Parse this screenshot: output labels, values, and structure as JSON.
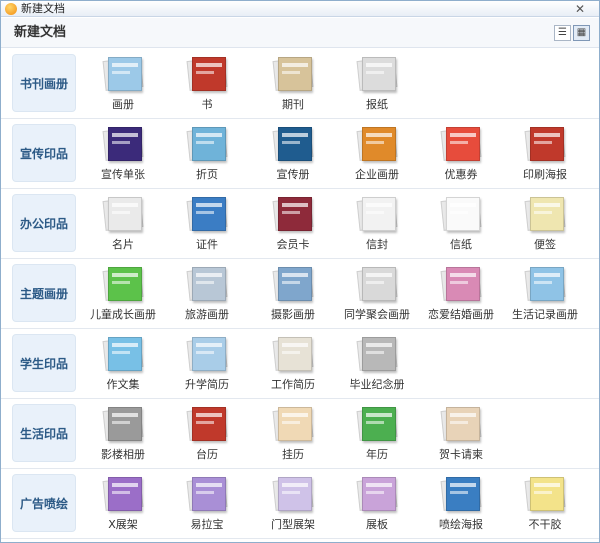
{
  "window": {
    "title": "新建文档",
    "close_glyph": "✕"
  },
  "header": {
    "heading": "新建文档",
    "list_view_glyph": "☰",
    "grid_view_glyph": "▦"
  },
  "categories": [
    {
      "label": "书刊画册",
      "items": [
        "画册",
        "书",
        "期刊",
        "报纸"
      ]
    },
    {
      "label": "宣传印品",
      "items": [
        "宣传单张",
        "折页",
        "宣传册",
        "企业画册",
        "优惠券",
        "印刷海报"
      ]
    },
    {
      "label": "办公印品",
      "items": [
        "名片",
        "证件",
        "会员卡",
        "信封",
        "信纸",
        "便签"
      ]
    },
    {
      "label": "主题画册",
      "items": [
        "儿童成长画册",
        "旅游画册",
        "摄影画册",
        "同学聚会画册",
        "恋爱结婚画册",
        "生活记录画册"
      ]
    },
    {
      "label": "学生印品",
      "items": [
        "作文集",
        "升学简历",
        "工作简历",
        "毕业纪念册"
      ]
    },
    {
      "label": "生活印品",
      "items": [
        "影楼相册",
        "台历",
        "挂历",
        "年历",
        "贺卡请柬"
      ]
    },
    {
      "label": "广告喷绘",
      "items": [
        "X展架",
        "易拉宝",
        "门型展架",
        "展板",
        "喷绘海报",
        "不干胶"
      ]
    }
  ],
  "thumbs": {
    "0": [
      "#9cc9e8",
      "#c0392b",
      "#d7c39a",
      "#dcdcdc"
    ],
    "1": [
      "#3b2a7a",
      "#6fb3d9",
      "#1f5c8f",
      "#e08a2a",
      "#e74c3c",
      "#c0392b"
    ],
    "2": [
      "#eaeaea",
      "#3b7dc4",
      "#8e2a3a",
      "#f2f2f2",
      "#fafafa",
      "#efe6b0"
    ],
    "3": [
      "#5cc24a",
      "#b8c7d6",
      "#7fa6cc",
      "#d9d9d9",
      "#d98ab5",
      "#8fc3e6"
    ],
    "4": [
      "#78c0e6",
      "#a9cde8",
      "#e7e2d6",
      "#b8b8b8"
    ],
    "5": [
      "#9a9a9a",
      "#c0392b",
      "#f0d9b5",
      "#4caf50",
      "#e8d3b8"
    ],
    "6": [
      "#9b6ec8",
      "#a98fd6",
      "#cfc2e8",
      "#c9a3d9",
      "#3a7ec2",
      "#f3e38a"
    ]
  }
}
